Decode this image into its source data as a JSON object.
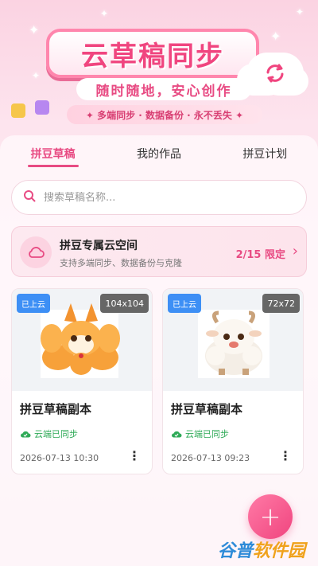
{
  "hero": {
    "title": "云草稿同步",
    "subtitle": "随时随地，安心创作",
    "tagline": "✦ 多端同步 · 数据备份 · 永不丢失 ✦"
  },
  "tabs": [
    {
      "label": "拼豆草稿",
      "active": true
    },
    {
      "label": "我的作品",
      "active": false
    },
    {
      "label": "拼豆计划",
      "active": false
    }
  ],
  "search": {
    "placeholder": "搜索草稿名称..."
  },
  "cloud_space": {
    "title": "拼豆专属云空间",
    "subtitle": "支持多端同步、数据备份与克隆",
    "limit": "2/15 限定"
  },
  "drafts": [
    {
      "badge": "已上云",
      "size": "104x104",
      "title": "拼豆草稿副本",
      "sync_status": "云端已同步",
      "date": "2026-07-13 10:30",
      "image": "fox-pixel-art"
    },
    {
      "badge": "已上云",
      "size": "72x72",
      "title": "拼豆草稿副本",
      "sync_status": "云端已同步",
      "date": "2026-07-13 09:23",
      "image": "sheep-pixel-art"
    }
  ],
  "fab": {
    "label": "+"
  },
  "watermark": {
    "part1": "谷普",
    "part2": "软件园"
  },
  "colors": {
    "accent": "#e84b83",
    "sync_green": "#2eaa57",
    "badge_blue": "#3d8ff5"
  }
}
